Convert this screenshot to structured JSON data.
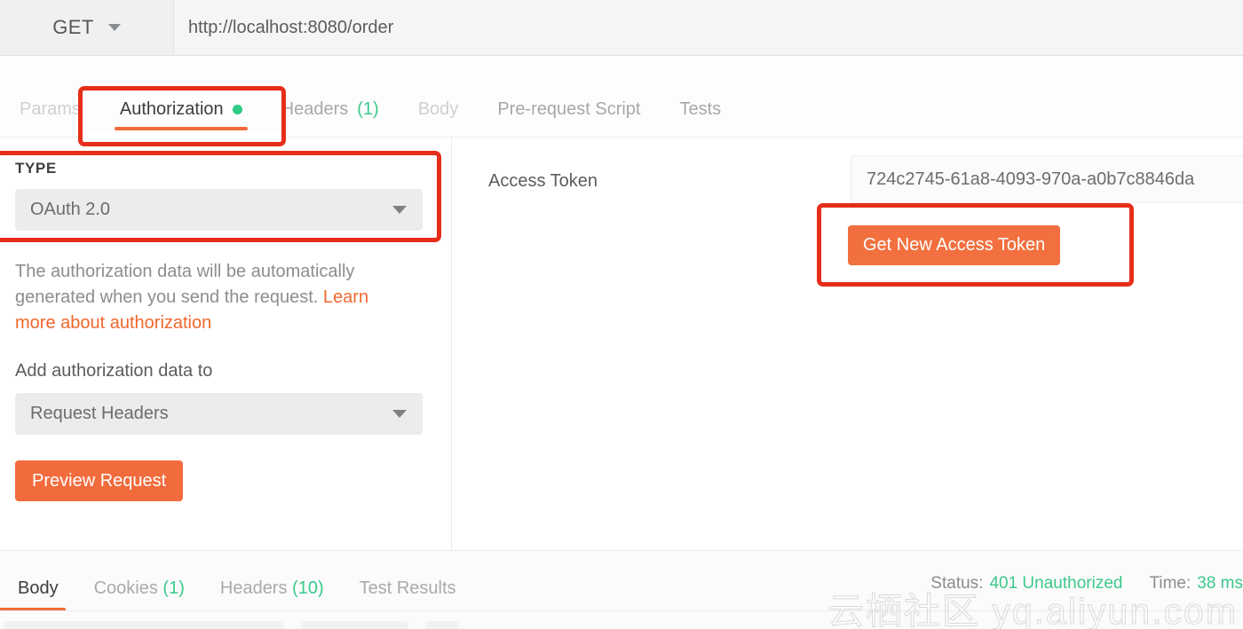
{
  "request_bar": {
    "method": "GET",
    "method_caret_icon": "chevron-down-icon",
    "url": "http://localhost:8080/order"
  },
  "request_tabs": [
    {
      "label": "Params",
      "state": "dim",
      "count": "",
      "dot": false
    },
    {
      "label": "Authorization",
      "state": "active",
      "count": "",
      "dot": true
    },
    {
      "label": "Headers",
      "state": "muted",
      "count": "(1)",
      "dot": false
    },
    {
      "label": "Body",
      "state": "dim",
      "count": "",
      "dot": false
    },
    {
      "label": "Pre-request Script",
      "state": "muted",
      "count": "",
      "dot": false
    },
    {
      "label": "Tests",
      "state": "muted",
      "count": "",
      "dot": false
    }
  ],
  "auth_panel": {
    "type_label": "TYPE",
    "type_value": "OAuth 2.0",
    "type_caret_icon": "chevron-down-icon",
    "helper_text": "The authorization data will be automatically generated when you send the request. ",
    "helper_link": "Learn more about authorization",
    "add_auth_label": "Add authorization data to",
    "add_auth_value": "Request Headers",
    "add_auth_caret_icon": "chevron-down-icon",
    "preview_button": "Preview Request"
  },
  "token_panel": {
    "access_token_label": "Access Token",
    "access_token_value": "724c2745-61a8-4093-970a-a0b7c8846da",
    "get_token_button": "Get New Access Token"
  },
  "response_tabs": [
    {
      "label": "Body",
      "state": "active",
      "count": ""
    },
    {
      "label": "Cookies",
      "state": "muted",
      "count": "(1)"
    },
    {
      "label": "Headers",
      "state": "muted",
      "count": "(10)"
    },
    {
      "label": "Test Results",
      "state": "muted",
      "count": ""
    }
  ],
  "response_meta": {
    "status_label": "Status:",
    "status_value": "401 Unauthorized",
    "time_label": "Time:",
    "time_value": "38 ms"
  },
  "watermark": "云栖社区 yq.aliyun.com",
  "colors": {
    "accent_orange": "#f26b3d",
    "highlight_red": "#e62e1b",
    "status_green": "#3cc98c",
    "indicator_green": "#2ecc84"
  }
}
